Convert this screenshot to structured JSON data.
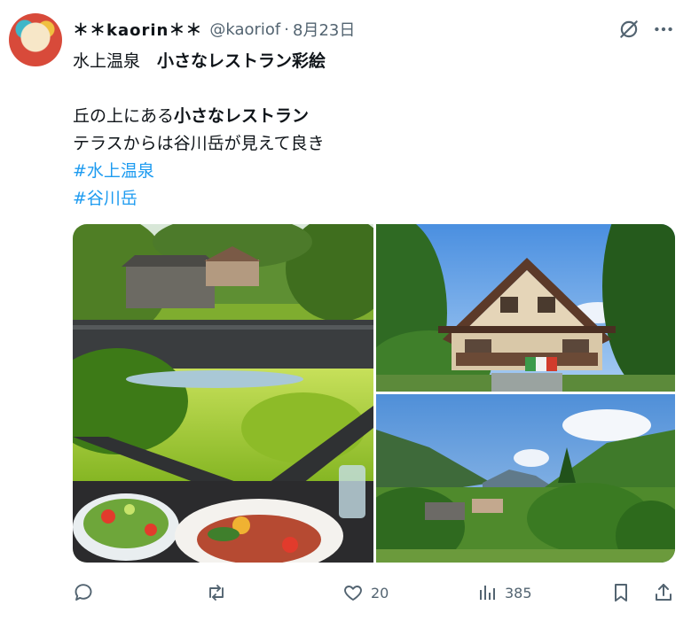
{
  "post": {
    "display_name": "＊＊kaorin＊＊",
    "handle": "@kaoriof",
    "separator": "·",
    "date": "8月23日",
    "text": {
      "line1_plain": "水上温泉　",
      "line1_bold": "小さなレストラン彩絵",
      "line2_plain": "丘の上にある",
      "line2_bold": "小さなレストラン",
      "line3": "テラスからは谷川岳が見えて良き",
      "hashtag1": "#水上温泉",
      "hashtag2": "#谷川岳"
    },
    "media_count": 3
  },
  "actions": {
    "reply_count": "",
    "retweet_count": "",
    "like_count": "20",
    "views_count": "385"
  },
  "icons": [
    "avatar",
    "grok-icon",
    "more-icon",
    "reply-icon",
    "retweet-icon",
    "like-icon",
    "views-icon",
    "bookmark-icon",
    "share-icon"
  ],
  "colors": {
    "text": "#0f1419",
    "secondary": "#536471",
    "hashtag": "#1d9bf0",
    "background": "#ffffff"
  }
}
